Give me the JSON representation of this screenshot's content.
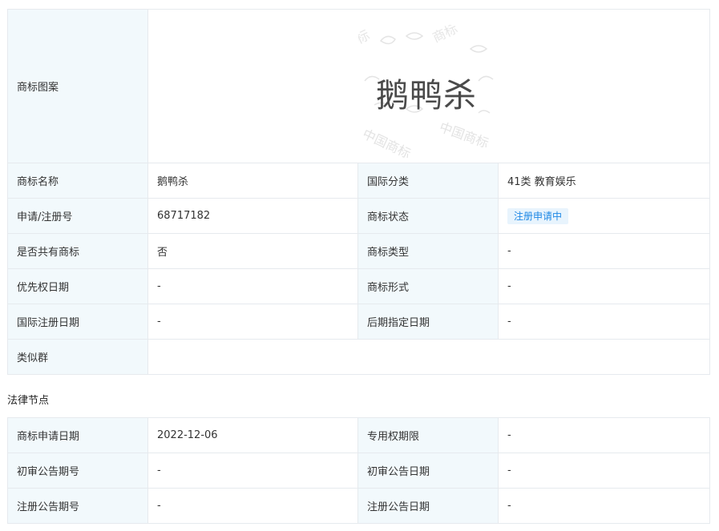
{
  "trademark": {
    "image_label": "商标图案",
    "image_text": "鹅鸭杀",
    "watermark_text": "中国商标",
    "rows": [
      {
        "l1": "商标名称",
        "v1": "鹅鸭杀",
        "l2": "国际分类",
        "v2": "41类 教育娱乐"
      },
      {
        "l1": "申请/注册号",
        "v1": "68717182",
        "l2": "商标状态",
        "v2": "注册申请中"
      },
      {
        "l1": "是否共有商标",
        "v1": "否",
        "l2": "商标类型",
        "v2": "-"
      },
      {
        "l1": "优先权日期",
        "v1": "-",
        "l2": "商标形式",
        "v2": "-"
      },
      {
        "l1": "国际注册日期",
        "v1": "-",
        "l2": "后期指定日期",
        "v2": "-"
      }
    ],
    "similar_group_label": "类似群",
    "similar_group_value": ""
  },
  "legal": {
    "title": "法律节点",
    "rows": [
      {
        "l1": "商标申请日期",
        "v1": "2022-12-06",
        "l2": "专用权期限",
        "v2": "-"
      },
      {
        "l1": "初审公告期号",
        "v1": "-",
        "l2": "初审公告日期",
        "v2": "-"
      },
      {
        "l1": "注册公告期号",
        "v1": "-",
        "l2": "注册公告日期",
        "v2": "-"
      }
    ]
  },
  "colors": {
    "label_bg": "#f2f9fc",
    "border": "#e6eaee",
    "badge_bg": "#e8f4fd",
    "badge_text": "#1e88e5"
  }
}
